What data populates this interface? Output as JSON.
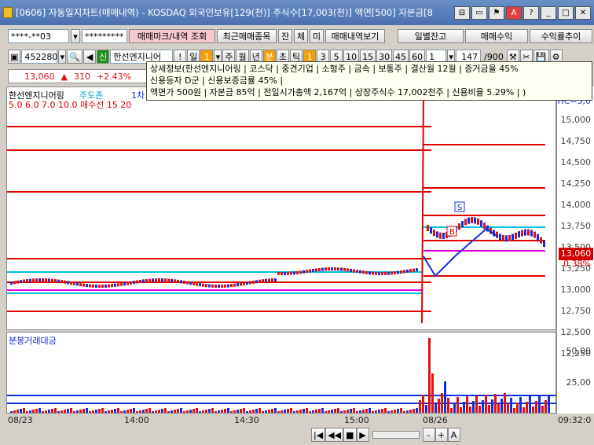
{
  "window": {
    "title": "[0606] 자동일지차트(매매내역) - KOSDAQ 외국인보유[129(천)] 주식수[17,003(천)] 액면[500] 자본금[8"
  },
  "toolbar1": {
    "account": "****-**03",
    "password": "*********",
    "btn_trade_mark": "매매마크/내역 조회",
    "btn_recent": "최근매매종목",
    "btn_jan": "잔",
    "btn_che": "체",
    "btn_mi": "미",
    "btn_trade_list": "매매내역보기",
    "btn_daily_balance": "일별잔고",
    "btn_trade_profit": "매매수익",
    "btn_profit_trend": "수익률추이"
  },
  "toolbar2": {
    "code": "452280",
    "credit": "신",
    "stock_name": "한선엔지니어",
    "excl": "!",
    "day_label": "일",
    "day_value": "1",
    "week": "주",
    "month": "월",
    "year": "년",
    "minute": "분",
    "second": "초",
    "tick": "틱",
    "intervals": [
      "1",
      "3",
      "5",
      "10",
      "15",
      "30",
      "45",
      "60"
    ],
    "interval_value": "1",
    "count_display": "147",
    "count_total": "/900"
  },
  "infobar": {
    "price": "13,060",
    "arrow": "▲",
    "change": "310",
    "change_rate": "+2.43%"
  },
  "tooltip": {
    "line1": "상세정보(한선엔지니어링 | 코스닥 | 중견기업 | 소형주 | 금속 | 보통주 | 결산월 12월 | 증거금율 45%",
    "line2": "신용등자 D군 | 신용보증금률 45% |",
    "line3": "액면가 500원 | 자본금 85억 | 전일시가총액 2,167억 | 상장주식수 17,002천주 | 신용비율 5.29% | )"
  },
  "chart": {
    "stock_label": "한선엔지니어링",
    "zone_label": "주도존",
    "ma_label": "1차",
    "ma_legend": "5.0  6.0  7.0  10.0  매수선  15  20",
    "axis_top_label": "HC=5,0",
    "current_price_tag": "13,060",
    "current_pct": "0.38%",
    "price_ticks": [
      "15,000",
      "14,750",
      "14,500",
      "14,250",
      "14,000",
      "13,750",
      "13,500",
      "13,250",
      "13,000",
      "12,750",
      "12,500",
      "12,250"
    ],
    "buy_marker": "B",
    "sell_marker": "S"
  },
  "volume": {
    "title": "분봉거래대금",
    "ticks": [
      "50,00",
      "25,00"
    ]
  },
  "timeline": {
    "labels": [
      "08/23",
      "14:00",
      "14:30",
      "15:00",
      "08/26"
    ],
    "right_time": "09:32:0"
  },
  "colors": {
    "up": "#e01010",
    "down": "#1030e0",
    "titlebar": "#5a80c0",
    "ma_red": "#e00000",
    "ma_blue": "#1040ff",
    "ma_cyan": "#00c0e0",
    "ma_magenta": "#e000e0"
  }
}
